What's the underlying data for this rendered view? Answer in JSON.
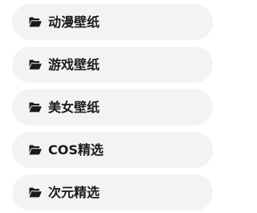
{
  "menu": {
    "items": [
      {
        "label": "动漫壁纸",
        "icon": "folder-open-icon"
      },
      {
        "label": "游戏壁纸",
        "icon": "folder-open-icon"
      },
      {
        "label": "美女壁纸",
        "icon": "folder-open-icon"
      },
      {
        "label": "COS精选",
        "icon": "folder-open-icon"
      },
      {
        "label": "次元精选",
        "icon": "folder-open-icon"
      }
    ]
  }
}
